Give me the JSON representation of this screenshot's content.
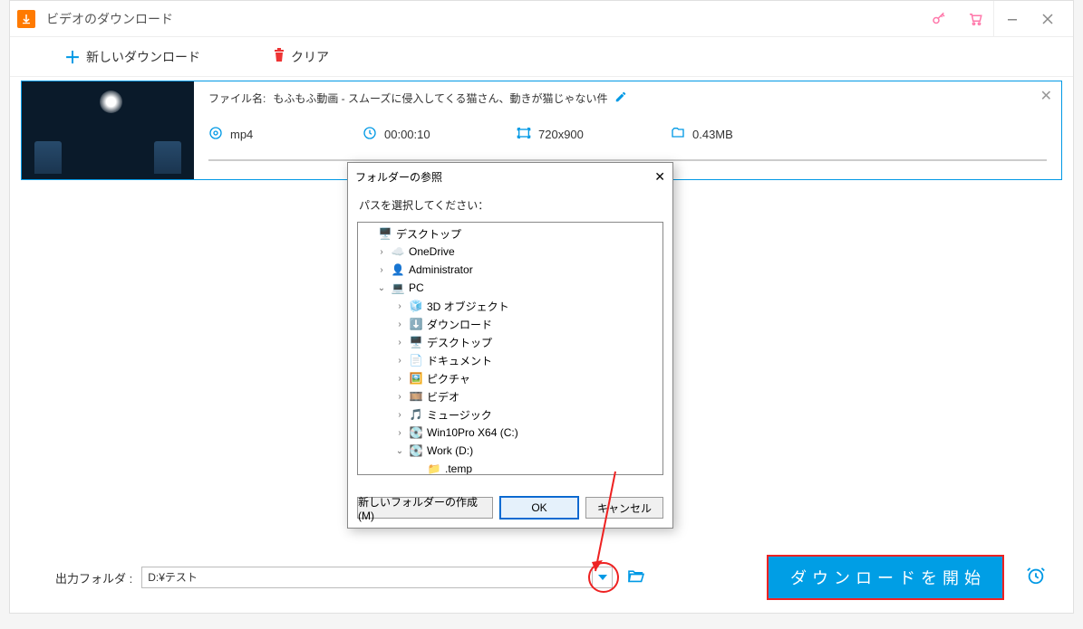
{
  "window": {
    "title": "ビデオのダウンロード"
  },
  "toolbar": {
    "new_download": "新しいダウンロード",
    "clear": "クリア"
  },
  "item": {
    "filename_label": "ファイル名:",
    "filename": "もふもふ動画 - スムーズに侵入してくる猫さん、動きが猫じゃない件",
    "format": "mp4",
    "duration": "00:00:10",
    "resolution": "720x900",
    "size": "0.43MB"
  },
  "dialog": {
    "title": "フォルダーの参照",
    "instruction": "パスを選択してください：",
    "new_folder": "新しいフォルダーの作成(M)",
    "ok": "OK",
    "cancel": "キャンセル",
    "tree": {
      "desktop": "デスクトップ",
      "onedrive": "OneDrive",
      "admin": "Administrator",
      "pc": "PC",
      "obj3d": "3D オブジェクト",
      "downloads": "ダウンロード",
      "desk2": "デスクトップ",
      "docs": "ドキュメント",
      "pics": "ピクチャ",
      "videos": "ビデオ",
      "music": "ミュージック",
      "cdrive": "Win10Pro X64 (C:)",
      "ddrive": "Work (D:)",
      "temp": ".temp"
    }
  },
  "bottom": {
    "label": "出力フォルダ :",
    "path": "D:¥テスト",
    "start": "ダウンロードを開始"
  }
}
